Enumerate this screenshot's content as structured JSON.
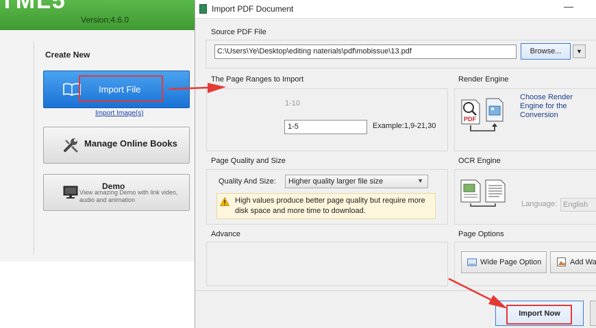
{
  "left_app": {
    "logo": "TML5",
    "version": "Version:4.6.0",
    "section_title": "Create New",
    "import_file": "Import File",
    "import_image_link": "Import Image(s)",
    "manage_online_books": "Manage Online Books",
    "demo_title": "Demo",
    "demo_desc": "View amazing Demo with link video, audio and animation"
  },
  "dialog": {
    "title": "Import PDF Document",
    "minimize": "—",
    "source": {
      "label": "Source PDF File",
      "path": "C:\\Users\\Ye\\Desktop\\editing naterials\\pdf\\mobissue\\13.pdf",
      "browse": "Browse...",
      "dropdown": "▼"
    },
    "page_range": {
      "label": "The Page Ranges to Import",
      "total": "1-10",
      "value": "1-5",
      "example": "Example:1,9-21,30"
    },
    "render_engine": {
      "label": "Render Engine",
      "desc": "Choose Render Engine for the Conversion"
    },
    "quality": {
      "label": "Page Quality and Size",
      "field_label": "Quality And Size:",
      "selected": "Higher quality larger file size",
      "warning": "High values produce better page quality but require more disk space and more time to download."
    },
    "ocr": {
      "label": "OCR Engine",
      "language_label": "Language:",
      "language": "English"
    },
    "advance": {
      "label": "Advance"
    },
    "page_options": {
      "label": "Page Options",
      "wide": "Wide Page Option",
      "add": "Add Wa"
    },
    "import_now": "Import Now"
  },
  "colors": {
    "header_green": "#4caf3f",
    "primary_blue": "#1a72d6",
    "annotation_red": "#e53935",
    "link_blue": "#1a3f8a"
  }
}
